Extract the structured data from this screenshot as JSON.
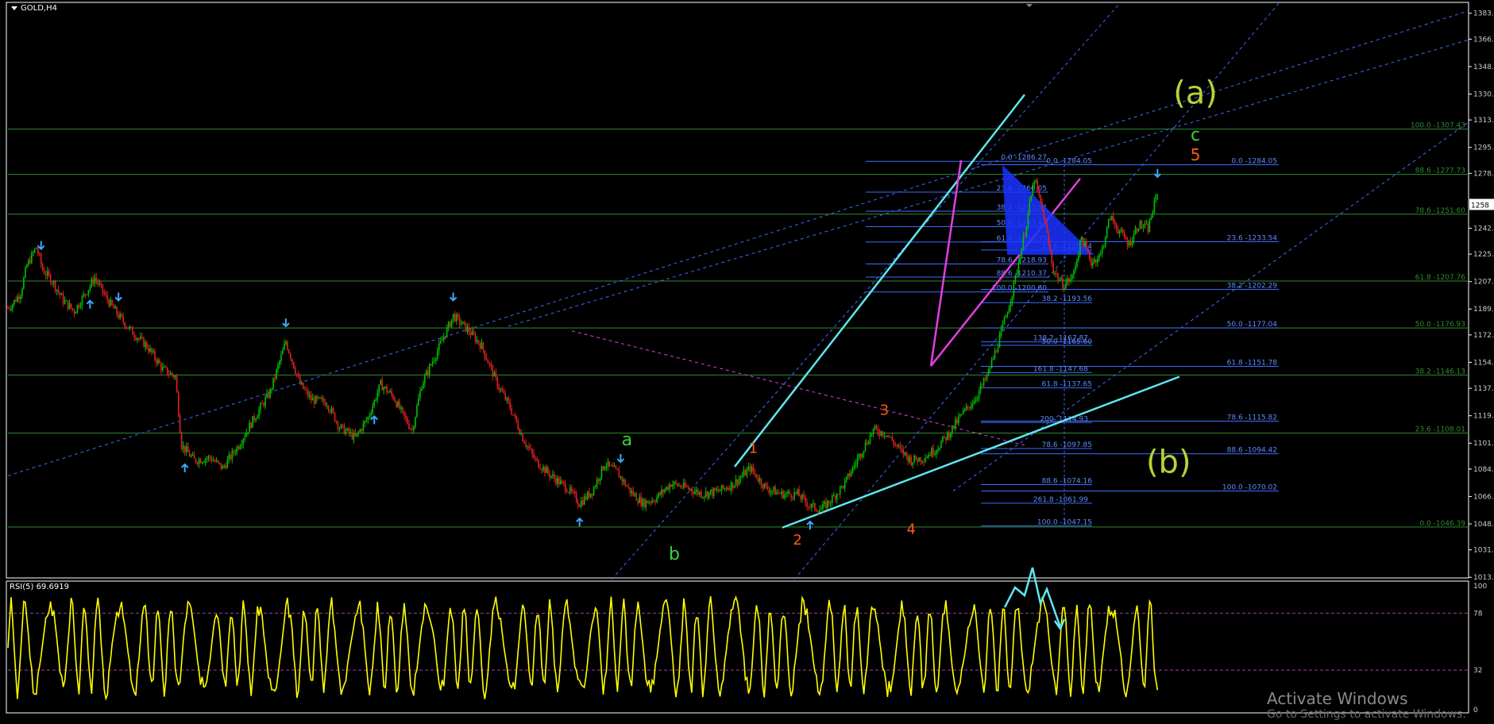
{
  "window": {
    "title": "GOLD,H4"
  },
  "rsi": {
    "label": "RSI(5) 69.6919",
    "levels": [
      "100",
      "78",
      "32",
      "0"
    ]
  },
  "watermark": {
    "line1": "Activate Windows",
    "line2": "Go to Settings to activate Windows."
  },
  "price_axis": {
    "ticks": [
      "1383.4",
      "1366.4",
      "1348.4",
      "1330.4",
      "1313.4",
      "1295.4",
      "1278.4",
      "1258",
      "1242.4",
      "1225.4",
      "1207.4",
      "1189.4",
      "1172.4",
      "1154.4",
      "1137.4",
      "1119.4",
      "1101.4",
      "1084.4",
      "1066.4",
      "1048.4",
      "1031.4",
      "1013.4"
    ],
    "current_price": "1258"
  },
  "colors": {
    "background": "#000000",
    "frame": "#ffffff",
    "bull_candle": "#00c000",
    "bear_candle": "#e02020",
    "rsi": "#ffff00",
    "fib": "#3c6cff",
    "fib_green": "#2f8a2f",
    "channel_cyan": "#5fe6f0",
    "channel_magenta": "#e040e0",
    "wave_green": "#3bd13b",
    "wave_orange": "#ff5a1a",
    "wave_lime": "#b5d335"
  },
  "chart_data": {
    "type": "line",
    "symbol": "GOLD",
    "timeframe": "H4",
    "ylim": [
      1013,
      1390
    ],
    "grid": false,
    "price_path": [
      [
        0,
        1190
      ],
      [
        3,
        1193
      ],
      [
        8,
        1200
      ],
      [
        12,
        1218
      ],
      [
        18,
        1230
      ],
      [
        22,
        1215
      ],
      [
        28,
        1208
      ],
      [
        35,
        1195
      ],
      [
        42,
        1188
      ],
      [
        48,
        1198
      ],
      [
        55,
        1210
      ],
      [
        62,
        1197
      ],
      [
        70,
        1185
      ],
      [
        78,
        1175
      ],
      [
        88,
        1165
      ],
      [
        98,
        1150
      ],
      [
        106,
        1145
      ],
      [
        110,
        1100
      ],
      [
        118,
        1090
      ],
      [
        128,
        1092
      ],
      [
        136,
        1085
      ],
      [
        146,
        1100
      ],
      [
        156,
        1118
      ],
      [
        166,
        1135
      ],
      [
        176,
        1168
      ],
      [
        185,
        1140
      ],
      [
        192,
        1130
      ],
      [
        202,
        1128
      ],
      [
        210,
        1112
      ],
      [
        220,
        1105
      ],
      [
        228,
        1118
      ],
      [
        236,
        1140
      ],
      [
        244,
        1132
      ],
      [
        250,
        1120
      ],
      [
        256,
        1110
      ],
      [
        262,
        1140
      ],
      [
        272,
        1162
      ],
      [
        282,
        1185
      ],
      [
        292,
        1175
      ],
      [
        300,
        1165
      ],
      [
        310,
        1140
      ],
      [
        318,
        1125
      ],
      [
        326,
        1105
      ],
      [
        334,
        1090
      ],
      [
        344,
        1080
      ],
      [
        354,
        1072
      ],
      [
        362,
        1062
      ],
      [
        370,
        1070
      ],
      [
        378,
        1088
      ],
      [
        386,
        1082
      ],
      [
        394,
        1070
      ],
      [
        402,
        1062
      ],
      [
        410,
        1065
      ],
      [
        420,
        1075
      ],
      [
        430,
        1072
      ],
      [
        440,
        1068
      ],
      [
        450,
        1070
      ],
      [
        460,
        1075
      ],
      [
        470,
        1085
      ],
      [
        480,
        1072
      ],
      [
        490,
        1068
      ],
      [
        500,
        1068
      ],
      [
        508,
        1060
      ],
      [
        515,
        1058
      ],
      [
        522,
        1065
      ],
      [
        530,
        1075
      ],
      [
        540,
        1095
      ],
      [
        548,
        1110
      ],
      [
        556,
        1108
      ],
      [
        564,
        1098
      ],
      [
        572,
        1090
      ],
      [
        580,
        1092
      ],
      [
        588,
        1098
      ],
      [
        596,
        1108
      ],
      [
        604,
        1120
      ],
      [
        612,
        1130
      ],
      [
        620,
        1145
      ],
      [
        628,
        1170
      ],
      [
        636,
        1200
      ],
      [
        644,
        1240
      ],
      [
        650,
        1275
      ],
      [
        656,
        1250
      ],
      [
        662,
        1215
      ],
      [
        668,
        1205
      ],
      [
        674,
        1210
      ],
      [
        680,
        1236
      ],
      [
        686,
        1220
      ],
      [
        692,
        1225
      ],
      [
        698,
        1250
      ],
      [
        704,
        1240
      ],
      [
        710,
        1232
      ],
      [
        716,
        1245
      ],
      [
        722,
        1242
      ],
      [
        728,
        1266
      ]
    ],
    "swing_markers": [
      {
        "bar": 21,
        "dir": "down",
        "color": "blue"
      },
      {
        "bar": 52,
        "dir": "up",
        "color": "blue"
      },
      {
        "bar": 70,
        "dir": "down",
        "color": "blue"
      },
      {
        "bar": 112,
        "dir": "up",
        "color": "blue"
      },
      {
        "bar": 176,
        "dir": "down",
        "color": "blue"
      },
      {
        "bar": 232,
        "dir": "up",
        "color": "blue"
      },
      {
        "bar": 282,
        "dir": "down",
        "color": "blue"
      },
      {
        "bar": 362,
        "dir": "up",
        "color": "blue"
      },
      {
        "bar": 388,
        "dir": "down",
        "color": "blue"
      },
      {
        "bar": 508,
        "dir": "up",
        "color": "blue"
      },
      {
        "bar": 728,
        "dir": "down",
        "color": "blue"
      }
    ],
    "wave_labels": [
      {
        "text": "(a)",
        "bar": 752,
        "price": 1324,
        "color": "lime",
        "size": 40
      },
      {
        "text": "c",
        "bar": 752,
        "price": 1300,
        "color": "green",
        "size": 22
      },
      {
        "text": "5",
        "bar": 752,
        "price": 1287,
        "color": "orange",
        "size": 20
      },
      {
        "text": "(b)",
        "bar": 735,
        "price": 1082,
        "color": "lime",
        "size": 40
      },
      {
        "text": "a",
        "bar": 392,
        "price": 1100,
        "color": "green",
        "size": 22
      },
      {
        "text": "b",
        "bar": 422,
        "price": 1025,
        "color": "green",
        "size": 22
      },
      {
        "text": "1",
        "bar": 472,
        "price": 1095,
        "color": "orange",
        "size": 18
      },
      {
        "text": "2",
        "bar": 500,
        "price": 1035,
        "color": "orange",
        "size": 18
      },
      {
        "text": "3",
        "bar": 555,
        "price": 1120,
        "color": "orange",
        "size": 18
      },
      {
        "text": "4",
        "bar": 572,
        "price": 1042,
        "color": "orange",
        "size": 18
      }
    ],
    "horizontal_levels_green": [
      {
        "label": "100.0 -1307.43",
        "price": 1307.43
      },
      {
        "label": "88.6 -1277.73",
        "price": 1277.73
      },
      {
        "label": "78.6 -1251.60",
        "price": 1251.6
      },
      {
        "label": "61.8 -1207.76",
        "price": 1207.76
      },
      {
        "label": "50.0 -1176.93",
        "price": 1176.93
      },
      {
        "label": "38.2 -1146.13",
        "price": 1146.13
      },
      {
        "label": "23.6 -1108.01",
        "price": 1108.01
      },
      {
        "label": "0.0 -1046.39",
        "price": 1046.39
      }
    ],
    "fib_levels_blue": [
      {
        "label": "0.0 -1286.27",
        "price": 1286.27,
        "set": "A"
      },
      {
        "label": "23.6 -1266.05",
        "price": 1266.05,
        "set": "A"
      },
      {
        "label": "38.2 -1253.54",
        "price": 1253.54,
        "set": "A"
      },
      {
        "label": "50.0 -1243.43",
        "price": 1243.43,
        "set": "A"
      },
      {
        "label": "61.8 -1233.33",
        "price": 1233.33,
        "set": "A"
      },
      {
        "label": "78.6 -1218.93",
        "price": 1218.93,
        "set": "A"
      },
      {
        "label": "88.6 -1210.37",
        "price": 1210.37,
        "set": "A"
      },
      {
        "label": "100.0 -1200.60",
        "price": 1200.6,
        "set": "A"
      },
      {
        "label": "0.0 -1284.05",
        "price": 1284.05,
        "set": "B"
      },
      {
        "label": "23.6 -1233.54",
        "price": 1233.54,
        "set": "B"
      },
      {
        "label": "38.2 -1202.29",
        "price": 1202.29,
        "set": "B"
      },
      {
        "label": "50.0 -1177.04",
        "price": 1177.04,
        "set": "B"
      },
      {
        "label": "61.8 -1151.78",
        "price": 1151.78,
        "set": "B"
      },
      {
        "label": "78.6 -1115.82",
        "price": 1115.82,
        "set": "B"
      },
      {
        "label": "88.6 -1094.42",
        "price": 1094.42,
        "set": "B"
      },
      {
        "label": "100.0 -1070.02",
        "price": 1070.02,
        "set": "B"
      },
      {
        "label": "0.0 -1284.05",
        "price": 1284.05,
        "set": "C"
      },
      {
        "label": "23.6 -1228.14",
        "price": 1228.14,
        "set": "C"
      },
      {
        "label": "38.2 -1193.56",
        "price": 1193.56,
        "set": "C"
      },
      {
        "label": "50.0 -1165.60",
        "price": 1165.6,
        "set": "C"
      },
      {
        "label": "61.8 -1137.65",
        "price": 1137.65,
        "set": "C"
      },
      {
        "label": "78.6 -1097.85",
        "price": 1097.85,
        "set": "C"
      },
      {
        "label": "88.6 -1074.16",
        "price": 1074.16,
        "set": "C"
      },
      {
        "label": "100.0 -1047.15",
        "price": 1047.15,
        "set": "C"
      },
      {
        "label": "138.2 -1167.87",
        "price": 1167.87,
        "set": "D"
      },
      {
        "label": "161.8 -1147.68",
        "price": 1147.68,
        "set": "D"
      },
      {
        "label": "200- 1114.93",
        "price": 1114.93,
        "set": "D"
      },
      {
        "label": "261.8 -1061.99",
        "price": 1061.99,
        "set": "D"
      }
    ]
  }
}
